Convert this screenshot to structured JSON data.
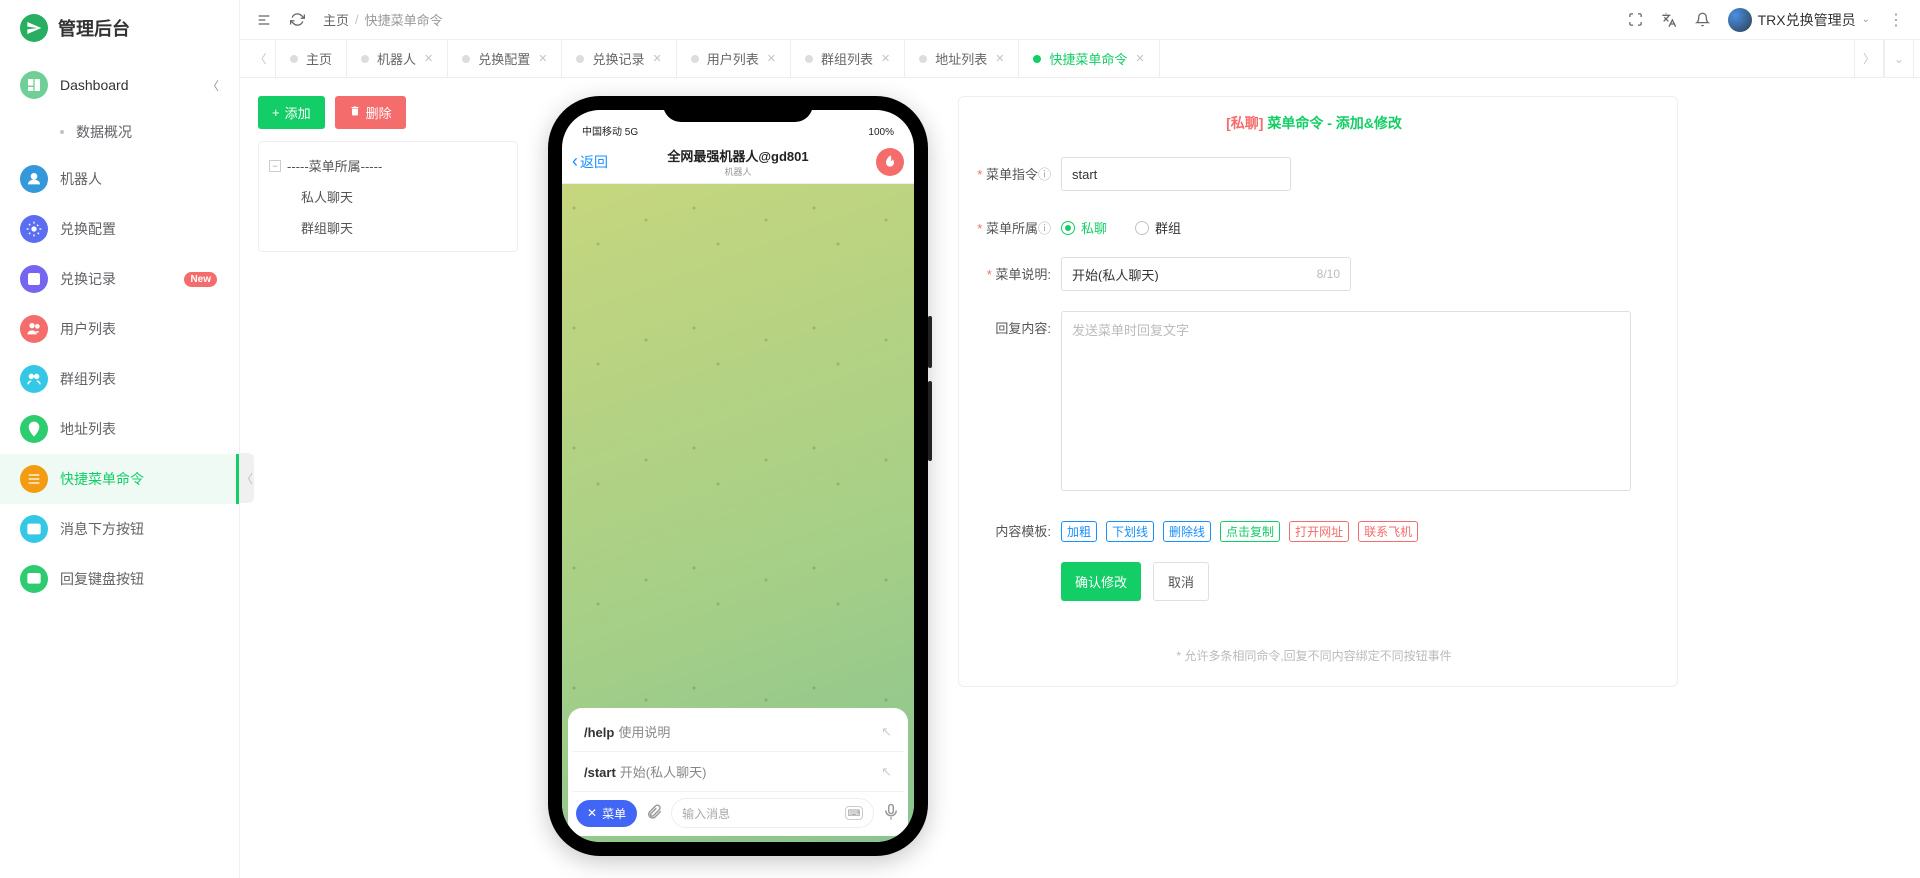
{
  "logo_text": "管理后台",
  "sidebar": {
    "dashboard": "Dashboard",
    "sub_overview": "数据概况",
    "items": [
      {
        "label": "机器人"
      },
      {
        "label": "兑换配置"
      },
      {
        "label": "兑换记录",
        "badge": "New"
      },
      {
        "label": "用户列表"
      },
      {
        "label": "群组列表"
      },
      {
        "label": "地址列表"
      },
      {
        "label": "快捷菜单命令",
        "active": true
      },
      {
        "label": "消息下方按钮"
      },
      {
        "label": "回复键盘按钮"
      }
    ]
  },
  "header": {
    "breadcrumb_home": "主页",
    "breadcrumb_current": "快捷菜单命令",
    "user_name": "TRX兑换管理员"
  },
  "tabs": [
    {
      "label": "主页"
    },
    {
      "label": "机器人",
      "closable": true
    },
    {
      "label": "兑换配置",
      "closable": true
    },
    {
      "label": "兑换记录",
      "closable": true
    },
    {
      "label": "用户列表",
      "closable": true
    },
    {
      "label": "群组列表",
      "closable": true
    },
    {
      "label": "地址列表",
      "closable": true
    },
    {
      "label": "快捷菜单命令",
      "closable": true,
      "active": true
    }
  ],
  "left_panel": {
    "btn_add": "添加",
    "btn_delete": "删除",
    "tree_root": "-----菜单所属-----",
    "tree_children": [
      "私人聊天",
      "群组聊天"
    ]
  },
  "phone": {
    "status_left": "中国移动 5G",
    "status_right": "100%",
    "back": "返回",
    "title": "全网最强机器人@gd801",
    "subtitle": "机器人",
    "commands": [
      {
        "cmd": "/help",
        "desc": "使用说明"
      },
      {
        "cmd": "/start",
        "desc": "开始(私人聊天)"
      }
    ],
    "menu_btn": "菜单",
    "input_placeholder": "输入消息"
  },
  "form": {
    "title_tag": "[私聊]",
    "title_rest": "菜单命令 - 添加&修改",
    "label_command": "菜单指令",
    "value_command": "start",
    "label_owner": "菜单所属",
    "radio_private": "私聊",
    "radio_group": "群组",
    "label_desc": "菜单说明:",
    "value_desc": "开始(私人聊天)",
    "desc_counter": "8/10",
    "label_reply": "回复内容:",
    "placeholder_reply": "发送菜单时回复文字",
    "label_template": "内容模板:",
    "templates": [
      {
        "label": "加粗",
        "color": "#1890ff"
      },
      {
        "label": "下划线",
        "color": "#1890ff"
      },
      {
        "label": "删除线",
        "color": "#1890ff"
      },
      {
        "label": "点击复制",
        "color": "#13ce66"
      },
      {
        "label": "打开网址",
        "color": "#f56c6c"
      },
      {
        "label": "联系飞机",
        "color": "#f56c6c"
      }
    ],
    "btn_submit": "确认修改",
    "btn_cancel": "取消",
    "note": "* 允许多条相同命令,回复不同内容绑定不同按钮事件"
  },
  "icons": {
    "menu_colors": [
      "#6fcf97",
      "#3498db",
      "#5b6df0",
      "#7565f0",
      "#f56c6c",
      "#35c8e6",
      "#2ecc71",
      "#f39c12",
      "#35c8e6",
      "#2ecc71"
    ]
  }
}
